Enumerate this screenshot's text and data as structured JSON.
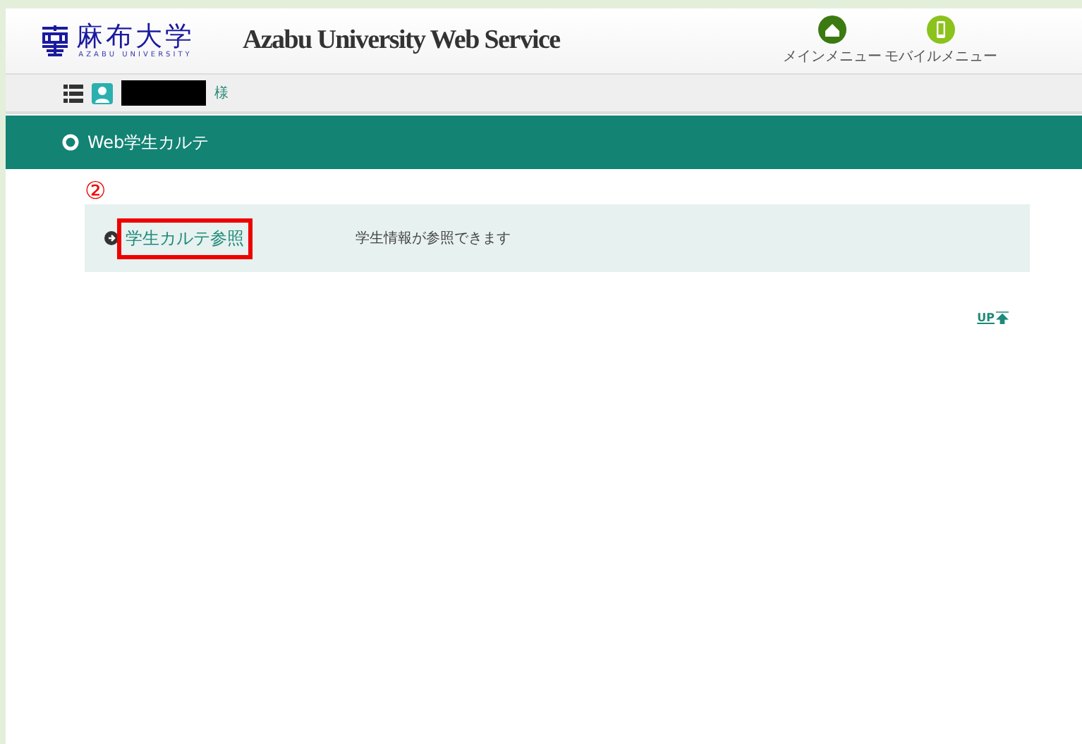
{
  "header": {
    "logo_text": "麻布大学",
    "logo_subtext": "AZABU UNIVERSITY",
    "title": "Azabu University Web Service",
    "menu_buttons": [
      {
        "label": "メインメニュー",
        "kind": "home"
      },
      {
        "label": "モバイルメニュー",
        "kind": "mobile"
      }
    ]
  },
  "user_bar": {
    "name_redacted": true,
    "honorific": "様"
  },
  "section": {
    "title": "Web学生カルテ"
  },
  "annotation": {
    "marker": "②"
  },
  "menu_items": [
    {
      "label": "学生カルテ参照",
      "description": "学生情報が参照できます",
      "highlighted": true
    }
  ],
  "up_link": {
    "label": "UP"
  }
}
